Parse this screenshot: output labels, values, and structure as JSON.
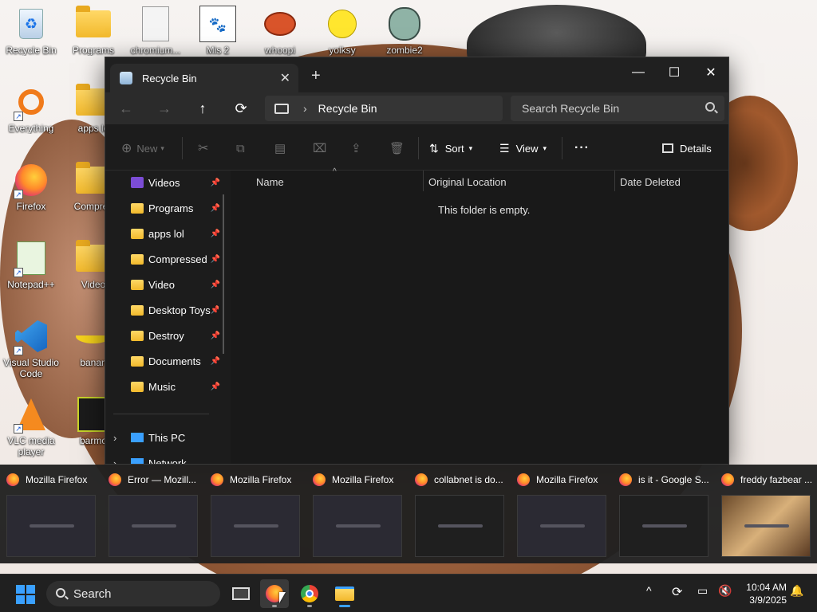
{
  "desktop": {
    "icons": [
      {
        "label": "Recycle Bin"
      },
      {
        "label": "Programs"
      },
      {
        "label": "chromium..."
      },
      {
        "label": "Mis 2"
      },
      {
        "label": "whoopi"
      },
      {
        "label": "yolksy"
      },
      {
        "label": "zombie2"
      },
      {
        "label": "Everything"
      },
      {
        "label": "apps lo"
      },
      {
        "label": "Firefox"
      },
      {
        "label": "Compres"
      },
      {
        "label": "Notepad++"
      },
      {
        "label": "Video"
      },
      {
        "label": "Visual Studio Code"
      },
      {
        "label": "banan"
      },
      {
        "label": "VLC media player"
      },
      {
        "label": "barmo"
      }
    ]
  },
  "explorer": {
    "tab_title": "Recycle Bin",
    "address_location": "Recycle Bin",
    "search_placeholder": "Search Recycle Bin",
    "toolbar": {
      "new_label": "New",
      "sort_label": "Sort",
      "view_label": "View",
      "more_label": "···",
      "details_label": "Details"
    },
    "nav_items": [
      {
        "label": "Videos"
      },
      {
        "label": "Programs"
      },
      {
        "label": "apps lol"
      },
      {
        "label": "Compressed"
      },
      {
        "label": "Video"
      },
      {
        "label": "Desktop Toys"
      },
      {
        "label": "Destroy"
      },
      {
        "label": "Documents"
      },
      {
        "label": "Music"
      }
    ],
    "tree": {
      "this_pc": "This PC",
      "network": "Network"
    },
    "columns": {
      "name": "Name",
      "original_location": "Original Location",
      "date_deleted": "Date Deleted"
    },
    "empty_message": "This folder is empty."
  },
  "thumbnails": [
    {
      "title": "Mozilla Firefox"
    },
    {
      "title": "Error — Mozill..."
    },
    {
      "title": "Mozilla Firefox"
    },
    {
      "title": "Mozilla Firefox"
    },
    {
      "title": "collabnet is do..."
    },
    {
      "title": "Mozilla Firefox"
    },
    {
      "title": "is it - Google S..."
    },
    {
      "title": "freddy fazbear ..."
    }
  ],
  "taskbar": {
    "search_label": "Search",
    "time": "10:04 AM",
    "date": "3/9/2025"
  },
  "colors": {
    "accent": "#3aa0ff",
    "window_bg": "#1c1c1c",
    "taskbar_bg": "#202020"
  }
}
